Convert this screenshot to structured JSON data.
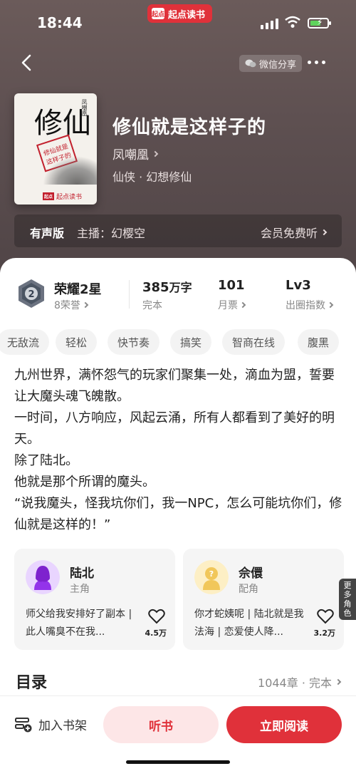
{
  "status_bar": {
    "time": "18:44",
    "app_name": "起点读书",
    "app_logo_text": "起点"
  },
  "header": {
    "share_label": "微信分享"
  },
  "book": {
    "title": "修仙就是这样子的",
    "author": "凤嘲凰",
    "genre": "仙侠 · 幻想修仙",
    "cover": {
      "calligraphy": "修仙",
      "author": "凤嘲凰",
      "subtitle": "修仙就是这样子的",
      "brand": "起点读书",
      "brand_logo": "起点"
    }
  },
  "audio": {
    "label": "有声版",
    "narrator": "主播：幻樱空",
    "free_label": "会员免费听"
  },
  "stats": {
    "rank_title": "荣耀2星",
    "rank_sub": "8荣誉",
    "words_value": "385",
    "words_unit": "万字",
    "words_sub": "完本",
    "tickets_value": "101",
    "tickets_sub": "月票",
    "level_value": "Lv3",
    "level_sub": "出圈指数"
  },
  "tags": [
    "无敌流",
    "轻松",
    "快节奏",
    "搞笑",
    "智商在线",
    "腹黑"
  ],
  "description": [
    "九州世界，满怀怨气的玩家们聚集一处，滴血为盟，誓要让大魔头魂飞魄散。",
    "一时间，八方响应，风起云涌，所有人都看到了美好的明天。",
    "除了陆北。",
    "他就是那个所谓的魔头。",
    "“说我魔头，怪我坑你们，我一NPC，怎么可能坑你们，修仙就是这样的！”"
  ],
  "characters": [
    {
      "name": "陆北",
      "role": "主角",
      "quote": "师父给我安排好了副本 | 此人嘴臭不在我...",
      "likes": "4.5万"
    },
    {
      "name": "佘儇",
      "role": "配角",
      "quote": "你才蛇姨呢 | 陆北就是我法海 | 恋爱使人降...",
      "likes": "3.2万"
    }
  ],
  "more_roles": "更多角色",
  "toc": {
    "title": "目录",
    "meta": "1044章 · 完本"
  },
  "actions": {
    "shelf": "加入书架",
    "listen": "听书",
    "read": "立即阅读"
  },
  "colors": {
    "accent": "#e0313a",
    "hero_bg": "#5e5051"
  }
}
